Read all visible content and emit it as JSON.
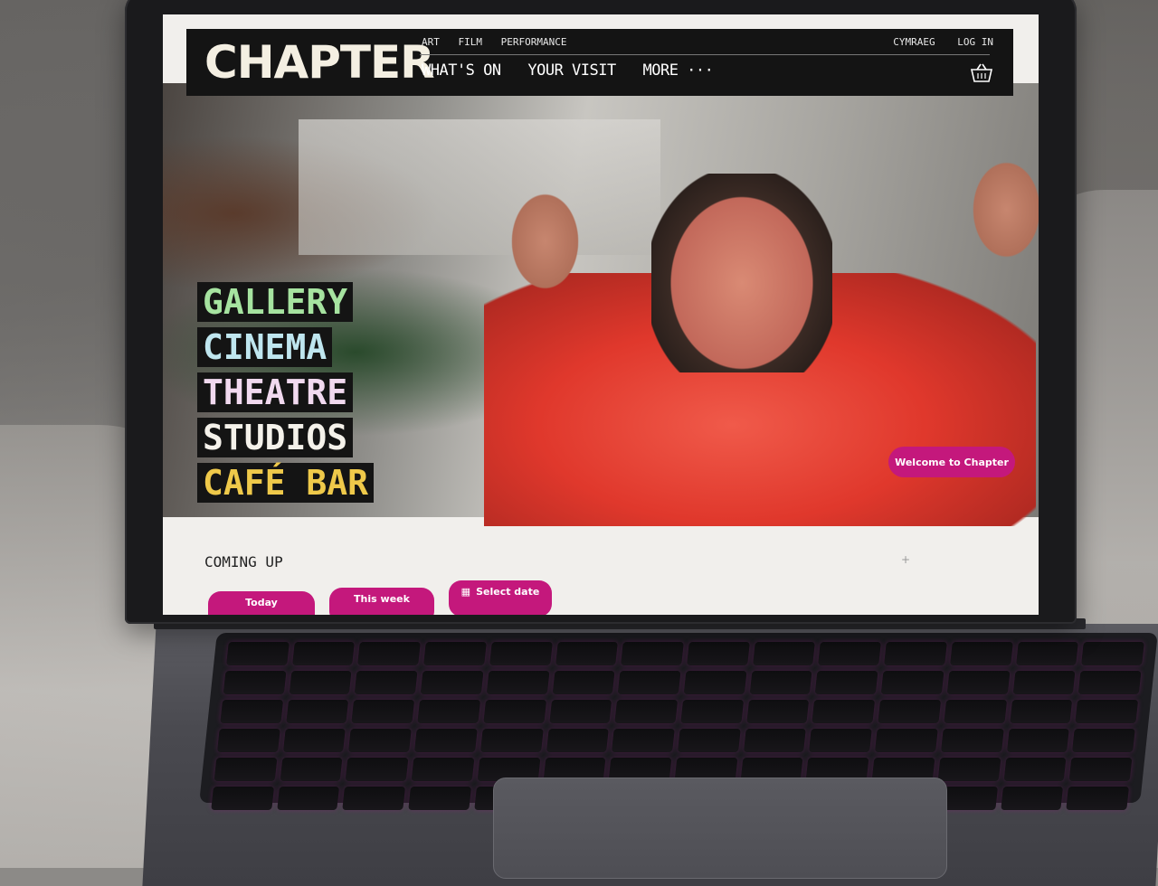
{
  "site": {
    "logo": "CHAPTER",
    "top_links": [
      "ART",
      "FILM",
      "PERFORMANCE"
    ],
    "main_nav": [
      "WHAT'S ON",
      "YOUR VISIT",
      "MORE ···"
    ],
    "util_links": [
      "CYMRAEG",
      "LOG IN"
    ],
    "basket_icon": "basket-icon"
  },
  "hero": {
    "words": [
      {
        "text": "GALLERY",
        "color": "#a6e3a0"
      },
      {
        "text": "CINEMA",
        "color": "#bfe6ef"
      },
      {
        "text": "THEATRE",
        "color": "#f1d9ef"
      },
      {
        "text": "STUDIOS",
        "color": "#f4f1ea"
      },
      {
        "text": "CAFÉ BAR",
        "color": "#efc94a"
      }
    ],
    "welcome_button": "Welcome to Chapter"
  },
  "coming_up": {
    "heading": "COMING UP",
    "filters": [
      "Today",
      "This week",
      "Select date"
    ]
  },
  "colors": {
    "accent": "#c4187c",
    "header_bg": "#141414"
  }
}
